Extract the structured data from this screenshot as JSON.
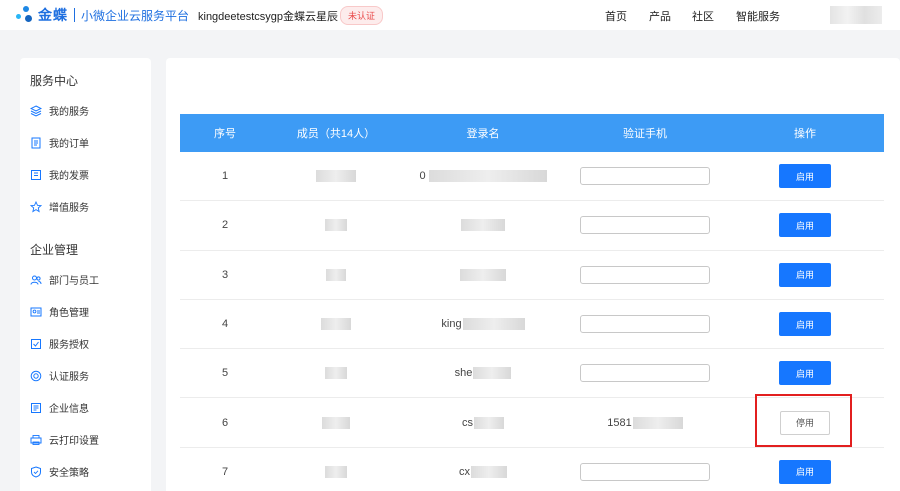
{
  "header": {
    "logo_text": "金蝶",
    "logo_sub": "小微企业云服务平台",
    "company": "kingdeetestcsygp金蝶云星辰",
    "status_badge": "未认证",
    "nav": [
      "首页",
      "产品",
      "社区",
      "智能服务"
    ]
  },
  "sidebar": {
    "section1_title": "服务中心",
    "section1_items": [
      {
        "label": "我的服务",
        "icon": "layers-icon"
      },
      {
        "label": "我的订单",
        "icon": "order-icon"
      },
      {
        "label": "我的发票",
        "icon": "invoice-icon"
      },
      {
        "label": "增值服务",
        "icon": "star-icon"
      }
    ],
    "section2_title": "企业管理",
    "section2_items": [
      {
        "label": "部门与员工",
        "icon": "people-icon"
      },
      {
        "label": "角色管理",
        "icon": "role-icon"
      },
      {
        "label": "服务授权",
        "icon": "authorize-icon"
      },
      {
        "label": "认证服务",
        "icon": "certify-icon"
      },
      {
        "label": "企业信息",
        "icon": "company-info-icon"
      },
      {
        "label": "云打印设置",
        "icon": "printer-icon"
      },
      {
        "label": "安全策略",
        "icon": "shield-icon"
      }
    ]
  },
  "table": {
    "headers": [
      "序号",
      "成员（共14人）",
      "登录名",
      "验证手机",
      "操作"
    ],
    "rows": [
      {
        "index": "1",
        "login_prefix": "0",
        "phone": "",
        "action": "启用"
      },
      {
        "index": "2",
        "login_prefix": "",
        "phone": "",
        "action": "启用"
      },
      {
        "index": "3",
        "login_prefix": "",
        "phone": "",
        "action": "启用"
      },
      {
        "index": "4",
        "login_prefix": "king",
        "phone": "",
        "action": "启用"
      },
      {
        "index": "5",
        "login_prefix": "she",
        "phone": "",
        "action": "启用"
      },
      {
        "index": "6",
        "login_prefix": "cs",
        "phone": "1581",
        "action": "停用"
      },
      {
        "index": "7",
        "login_prefix": "cx",
        "phone": "",
        "action": "启用"
      }
    ]
  },
  "colors": {
    "accent": "#1677ff",
    "table_header": "#3d9bf5",
    "highlight": "#e21f1f"
  }
}
